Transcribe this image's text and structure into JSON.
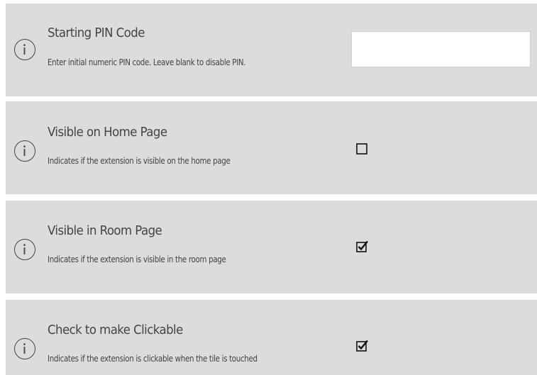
{
  "settings": [
    {
      "title": "Starting PIN Code",
      "description": "Enter initial numeric PIN code.  Leave blank to disable PIN.",
      "control": "text",
      "value": "",
      "placeholder": ""
    },
    {
      "title": "Visible on Home Page",
      "description": "Indicates if the extension is visible on the home page",
      "control": "checkbox",
      "checked": false
    },
    {
      "title": "Visible in Room Page",
      "description": "Indicates if the extension is visible in the room page",
      "control": "checkbox",
      "checked": true
    },
    {
      "title": "Check to make Clickable",
      "description": "Indicates if the extension is clickable when the tile is touched",
      "control": "checkbox",
      "checked": true
    }
  ],
  "icons": {
    "info": "info-icon",
    "checkbox_checked": "checkbox-checked-icon",
    "checkbox_unchecked": "checkbox-unchecked-icon"
  },
  "colors": {
    "row_background": "#dcdcdc",
    "text": "#444444",
    "input_background": "#ffffff"
  }
}
